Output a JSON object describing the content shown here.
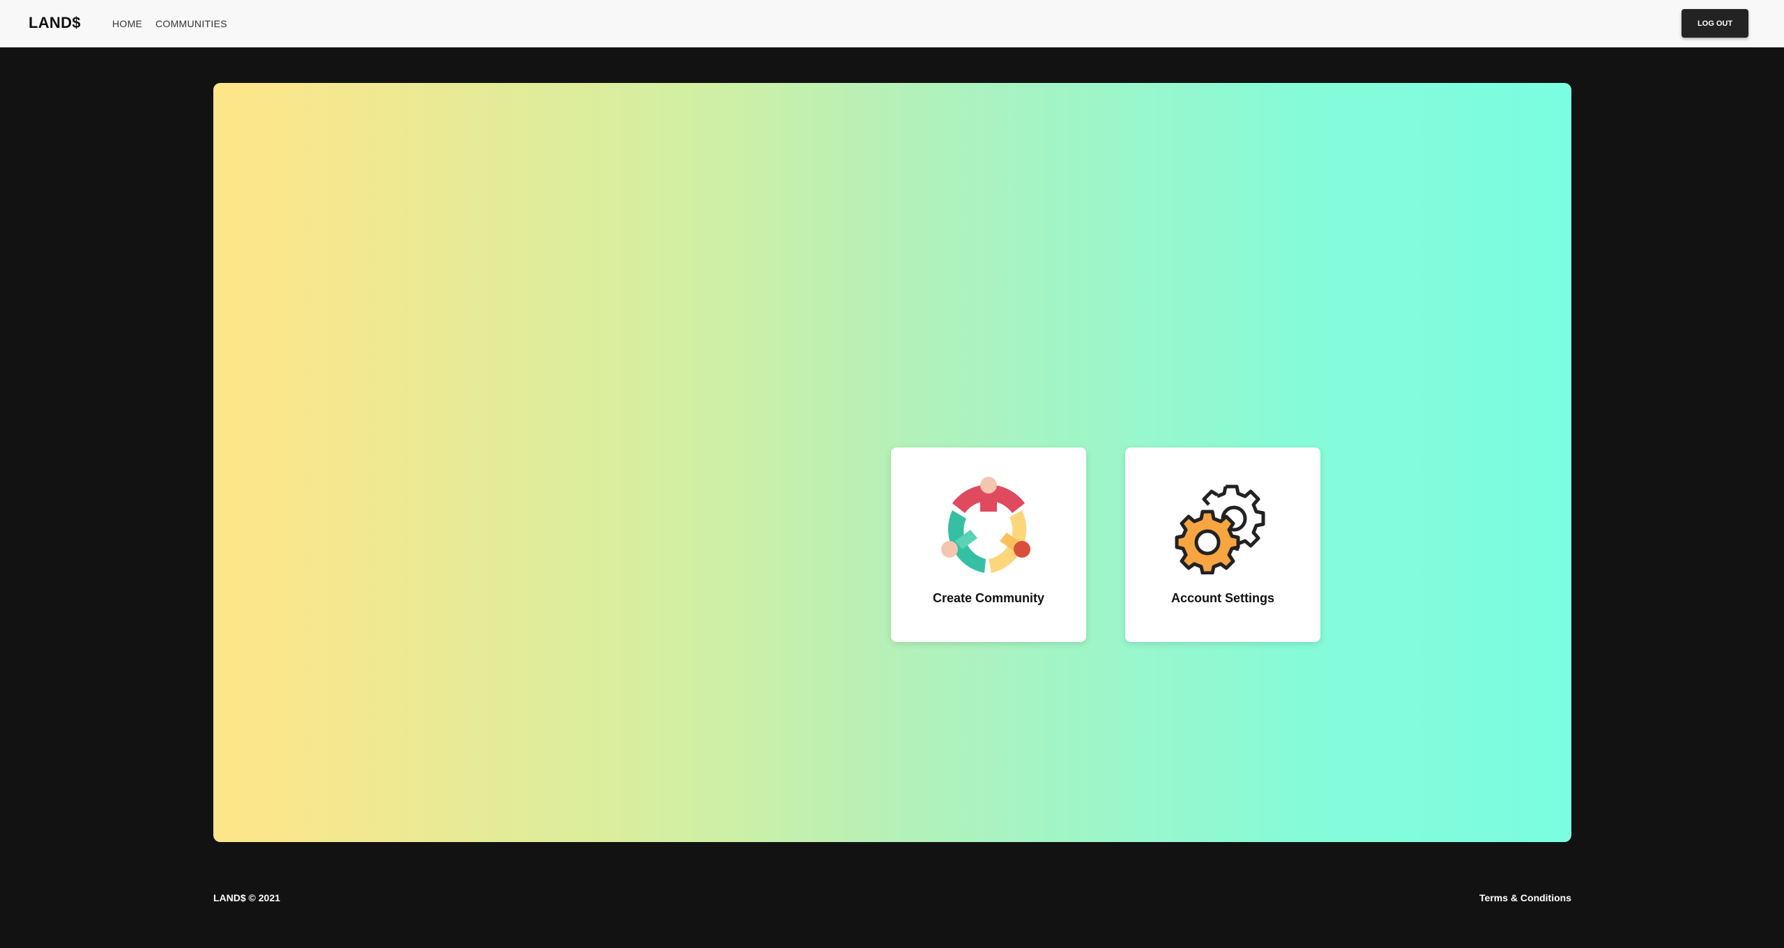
{
  "header": {
    "brand": "LAND$",
    "nav": [
      {
        "label": "HOME"
      },
      {
        "label": "COMMUNITIES"
      }
    ],
    "logout_label": "LOG OUT"
  },
  "hero": {
    "cards": [
      {
        "label": "Create Community",
        "icon": "community-icon"
      },
      {
        "label": "Account Settings",
        "icon": "gear-icon"
      }
    ]
  },
  "footer": {
    "copyright": "LAND$ © 2021",
    "terms": "Terms & Conditions"
  },
  "colors": {
    "page_bg": "#121212",
    "topbar_bg": "#f8f8f8",
    "gradient_start": "#fde68a",
    "gradient_end": "#7afde1",
    "button_bg": "#232323"
  }
}
